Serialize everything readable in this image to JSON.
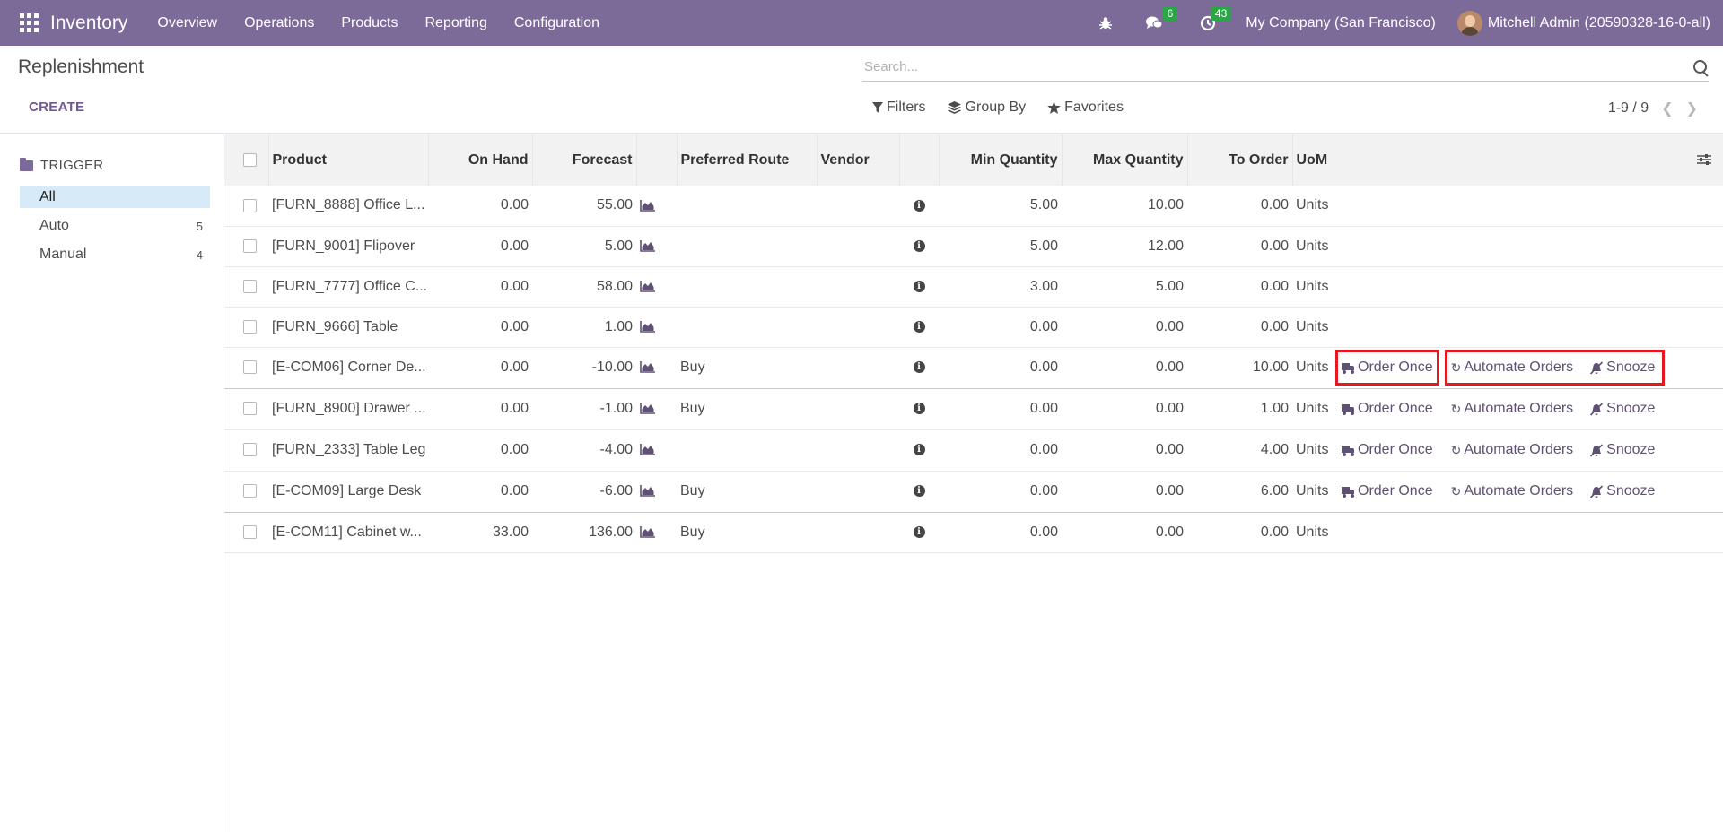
{
  "navbar": {
    "app_name": "Inventory",
    "menu": [
      "Overview",
      "Operations",
      "Products",
      "Reporting",
      "Configuration"
    ],
    "messages_count": "6",
    "activities_count": "43",
    "company": "My Company (San Francisco)",
    "user": "Mitchell Admin (20590328-16-0-all)"
  },
  "control_panel": {
    "title": "Replenishment",
    "create_label": "CREATE",
    "search_placeholder": "Search...",
    "filters_label": "Filters",
    "groupby_label": "Group By",
    "favorites_label": "Favorites",
    "pager": "1-9 / 9"
  },
  "sidebar": {
    "header": "TRIGGER",
    "items": [
      {
        "label": "All",
        "count": ""
      },
      {
        "label": "Auto",
        "count": "5"
      },
      {
        "label": "Manual",
        "count": "4"
      }
    ]
  },
  "table": {
    "columns": {
      "product": "Product",
      "on_hand": "On Hand",
      "forecast": "Forecast",
      "route": "Preferred Route",
      "vendor": "Vendor",
      "min_qty": "Min Quantity",
      "max_qty": "Max Quantity",
      "to_order": "To Order",
      "uom": "UoM"
    },
    "actions": {
      "order_once": "Order Once",
      "automate": "Automate Orders",
      "snooze": "Snooze"
    },
    "rows": [
      {
        "product": "[FURN_8888] Office L...",
        "on_hand": "0.00",
        "forecast": "55.00",
        "route": "",
        "vendor": "",
        "min": "5.00",
        "max": "10.00",
        "to_order": "0.00",
        "uom": "Units",
        "actions": false
      },
      {
        "product": "[FURN_9001] Flipover",
        "on_hand": "0.00",
        "forecast": "5.00",
        "route": "",
        "vendor": "",
        "min": "5.00",
        "max": "12.00",
        "to_order": "0.00",
        "uom": "Units",
        "actions": false
      },
      {
        "product": "[FURN_7777] Office C...",
        "on_hand": "0.00",
        "forecast": "58.00",
        "route": "",
        "vendor": "",
        "min": "3.00",
        "max": "5.00",
        "to_order": "0.00",
        "uom": "Units",
        "actions": false
      },
      {
        "product": "[FURN_9666] Table",
        "on_hand": "0.00",
        "forecast": "1.00",
        "route": "",
        "vendor": "",
        "min": "0.00",
        "max": "0.00",
        "to_order": "0.00",
        "uom": "Units",
        "actions": false
      },
      {
        "product": "[E-COM06] Corner De...",
        "on_hand": "0.00",
        "forecast": "-10.00",
        "route": "Buy",
        "vendor": "",
        "min": "0.00",
        "max": "0.00",
        "to_order": "10.00",
        "uom": "Units",
        "actions": true
      },
      {
        "product": "[FURN_8900] Drawer ...",
        "on_hand": "0.00",
        "forecast": "-1.00",
        "route": "Buy",
        "vendor": "",
        "min": "0.00",
        "max": "0.00",
        "to_order": "1.00",
        "uom": "Units",
        "actions": true
      },
      {
        "product": "[FURN_2333] Table Leg",
        "on_hand": "0.00",
        "forecast": "-4.00",
        "route": "",
        "vendor": "",
        "min": "0.00",
        "max": "0.00",
        "to_order": "4.00",
        "uom": "Units",
        "actions": true
      },
      {
        "product": "[E-COM09] Large Desk",
        "on_hand": "0.00",
        "forecast": "-6.00",
        "route": "Buy",
        "vendor": "",
        "min": "0.00",
        "max": "0.00",
        "to_order": "6.00",
        "uom": "Units",
        "actions": true
      },
      {
        "product": "[E-COM11] Cabinet w...",
        "on_hand": "33.00",
        "forecast": "136.00",
        "route": "Buy",
        "vendor": "",
        "min": "0.00",
        "max": "0.00",
        "to_order": "0.00",
        "uom": "Units",
        "actions": false
      }
    ]
  }
}
